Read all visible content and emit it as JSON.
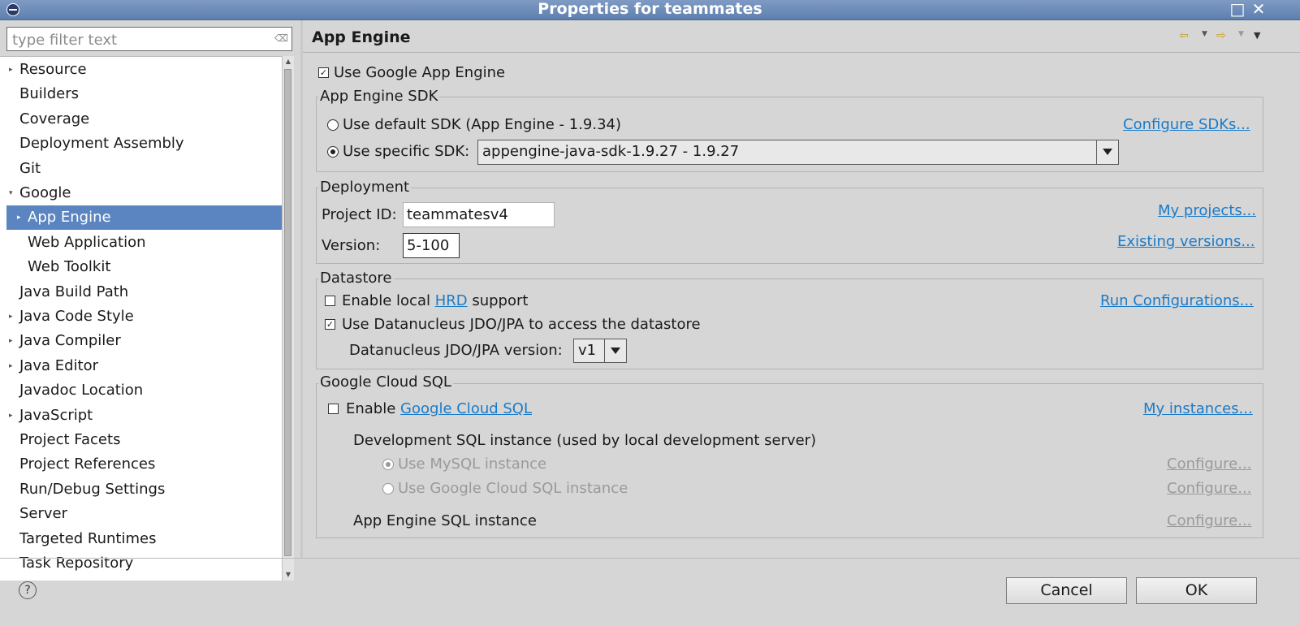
{
  "window": {
    "title": "Properties for teammates"
  },
  "filter": {
    "placeholder": "type filter text"
  },
  "tree": {
    "items": [
      {
        "label": "Resource",
        "expandable": true
      },
      {
        "label": "Builders",
        "expandable": false
      },
      {
        "label": "Coverage",
        "expandable": false
      },
      {
        "label": "Deployment Assembly",
        "expandable": false
      },
      {
        "label": "Git",
        "expandable": false
      },
      {
        "label": "Google",
        "expandable": true,
        "expanded": true
      },
      {
        "label": "App Engine",
        "expandable": true,
        "selected": true,
        "indent": 1
      },
      {
        "label": "Web Application",
        "expandable": false,
        "indent": 1
      },
      {
        "label": "Web Toolkit",
        "expandable": false,
        "indent": 1
      },
      {
        "label": "Java Build Path",
        "expandable": false
      },
      {
        "label": "Java Code Style",
        "expandable": true
      },
      {
        "label": "Java Compiler",
        "expandable": true
      },
      {
        "label": "Java Editor",
        "expandable": true
      },
      {
        "label": "Javadoc Location",
        "expandable": false
      },
      {
        "label": "JavaScript",
        "expandable": true
      },
      {
        "label": "Project Facets",
        "expandable": false
      },
      {
        "label": "Project References",
        "expandable": false
      },
      {
        "label": "Run/Debug Settings",
        "expandable": false
      },
      {
        "label": "Server",
        "expandable": false
      },
      {
        "label": "Targeted Runtimes",
        "expandable": false
      },
      {
        "label": "Task Repository",
        "expandable": false
      }
    ]
  },
  "page": {
    "title": "App Engine",
    "use_gae_label": "Use Google App Engine",
    "use_gae_checked": true,
    "sdk": {
      "group_label": "App Engine SDK",
      "default_label": "Use default SDK (App Engine - 1.9.34)",
      "specific_label": "Use specific SDK:",
      "selected": "specific",
      "configure_link": "Configure SDKs...",
      "combo_value": "appengine-java-sdk-1.9.27 - 1.9.27"
    },
    "deployment": {
      "group_label": "Deployment",
      "project_id_label": "Project ID:",
      "project_id_value": "teammatesv4",
      "version_label": "Version:",
      "version_value": "5-100",
      "my_projects_link": "My projects...",
      "existing_versions_link": "Existing versions..."
    },
    "datastore": {
      "group_label": "Datastore",
      "enable_prefix": "Enable local ",
      "hrd_link": "HRD",
      "enable_suffix": " support",
      "enable_checked": false,
      "run_config_link": "Run Configurations...",
      "datanucleus_label": "Use Datanucleus JDO/JPA to access the datastore",
      "datanucleus_checked": true,
      "version_label": "Datanucleus JDO/JPA version:",
      "version_value": "v1"
    },
    "cloudsql": {
      "group_label": "Google Cloud SQL",
      "enable_prefix": "Enable ",
      "enable_link": "Google Cloud SQL",
      "enable_checked": false,
      "my_instances_link": "My instances...",
      "dev_instance_label": "Development SQL instance (used by local development server)",
      "mysql_label": "Use MySQL instance",
      "gcsql_label": "Use Google Cloud SQL instance",
      "configure_label": "Configure...",
      "appengine_instance_label": "App Engine SQL instance"
    }
  },
  "buttons": {
    "help": "?",
    "cancel": "Cancel",
    "ok": "OK"
  },
  "icons": {
    "back": "back-arrow-icon",
    "forward": "forward-arrow-icon",
    "menu": "view-menu-icon"
  }
}
